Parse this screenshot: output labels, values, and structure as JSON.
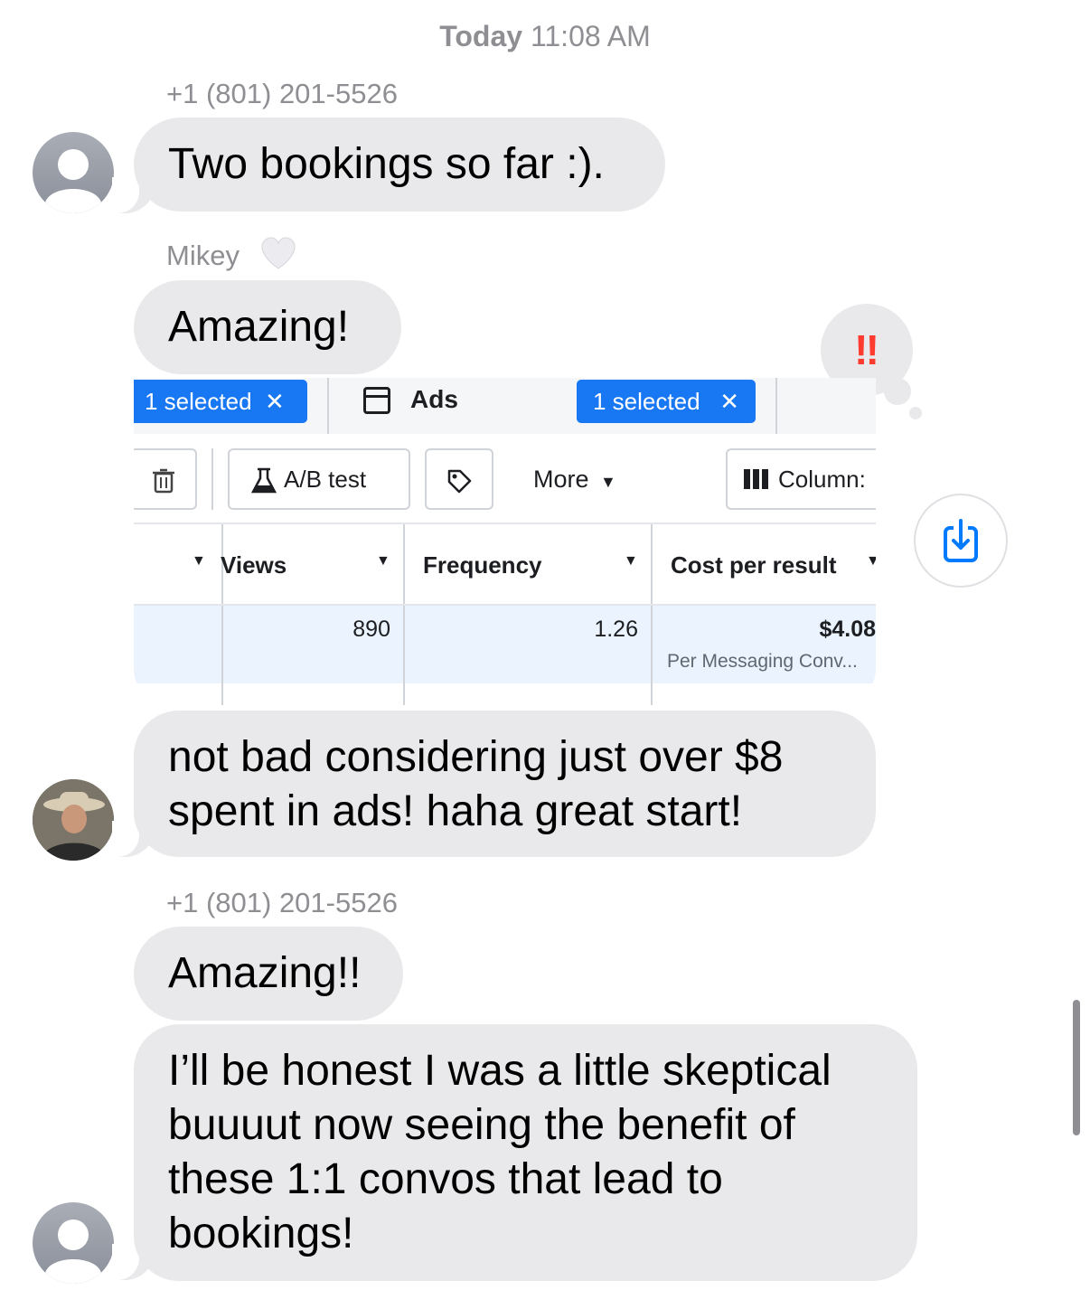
{
  "timestamp": {
    "day": "Today",
    "time": "11:08 AM"
  },
  "messages": {
    "m1": {
      "sender": "+1 (801) 201-5526",
      "text": "Two bookings so far :)."
    },
    "m2": {
      "sender": "Mikey",
      "text": "Amazing!"
    },
    "m3": {
      "text_line1": "not bad considering just over $8",
      "text_line2": "spent in ads! haha great start!"
    },
    "m4": {
      "sender": "+1 (801) 201-5526",
      "text": "Amazing!!"
    },
    "m5": {
      "line1": "I’ll be honest I was a little skeptical",
      "line2": "buuuut now seeing the benefit of",
      "line3": "these 1:1 convos that lead to",
      "line4": "bookings!"
    }
  },
  "reaction": {
    "icon": "double-exclamation-icon",
    "glyph": "‼"
  },
  "attachment": {
    "chip1": "1 selected",
    "ads_tab": "Ads",
    "chip2": "1 selected",
    "ab_test": "A/B test",
    "more": "More",
    "columns": "Column:",
    "headers": {
      "views": "Views",
      "frequency": "Frequency",
      "cost": "Cost per result"
    },
    "row1": {
      "views": "890",
      "frequency": "1.26",
      "cost": "$4.08",
      "cost_sub": "Per Messaging Conv..."
    }
  },
  "colors": {
    "bubble": "#e9e9eb",
    "meta_blue": "#1877f2",
    "reaction_red": "#ff3b30",
    "ios_blue": "#007aff"
  }
}
